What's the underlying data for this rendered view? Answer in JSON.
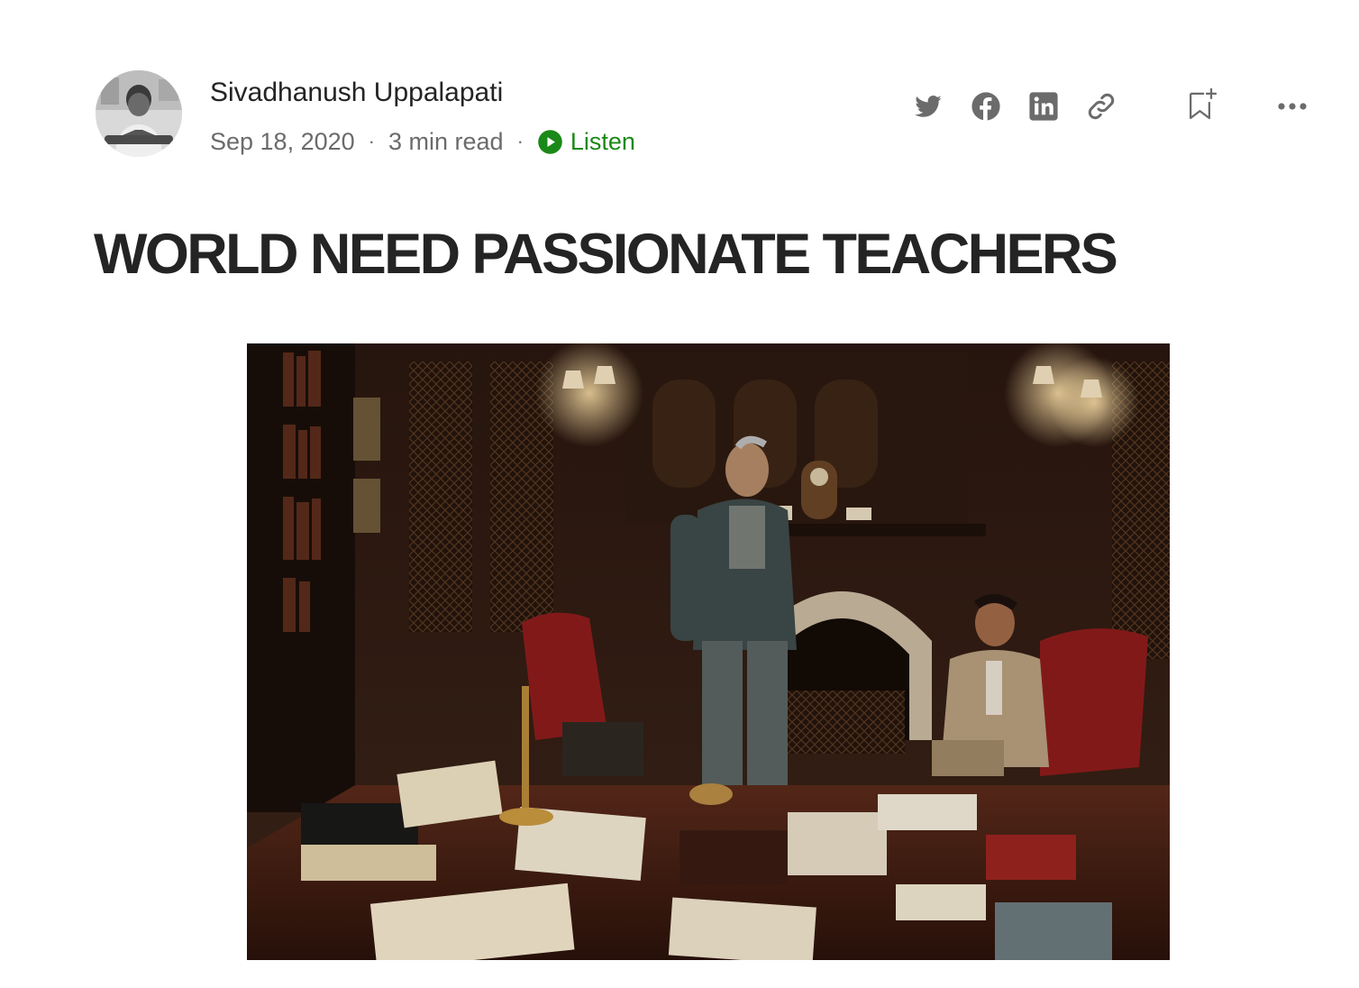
{
  "author": {
    "name": "Sivadhanush Uppalapati",
    "avatar_icon": "author-avatar-photo"
  },
  "meta": {
    "date": "Sep 18, 2020",
    "separator": "·",
    "read_time": "3 min read",
    "listen_label": "Listen",
    "listen_icon": "play-circle-icon",
    "listen_color": "#1a8917"
  },
  "share_icons": [
    "twitter-icon",
    "facebook-icon",
    "linkedin-icon",
    "link-icon"
  ],
  "actions": {
    "bookmark_icon": "bookmark-add-icon",
    "more_icon": "more-horizontal-icon"
  },
  "article": {
    "title": "WORLD NEED PASSIONATE TEACHERS",
    "hero_image": "photo-study-room-two-men-desk-fireplace"
  },
  "colors": {
    "text_primary": "#242424",
    "text_secondary": "#6b6b6b",
    "icon_gray": "#6b6b6b"
  }
}
